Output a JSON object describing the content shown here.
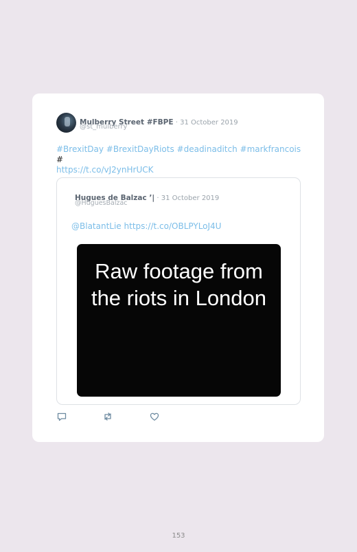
{
  "tweet": {
    "author_name": "Mulberry Street #FBPE",
    "separator": " · ",
    "date": "31 October 2019",
    "handle": "@st_mulberry",
    "text_links": "#BrexitDay #BrexitDayRiots #deadinaditch #markfrancois",
    "text_hash": " #",
    "text_url": "https://t.co/vJ2ynHrUCK"
  },
  "quoted_tweet": {
    "author_name": "Hugues de Balzac ’|",
    "separator": " · ",
    "date": "31 October 2019",
    "handle": "@HuguesBalzac",
    "text": "@BlatantLie https://t.co/OBLPYLoJ4U",
    "media_caption_line1": "Raw footage from",
    "media_caption_line2": "the riots in London"
  },
  "actions": {
    "icons": [
      "reply-icon",
      "retweet-icon",
      "like-icon"
    ]
  },
  "colors": {
    "link": "#7bbde8",
    "background": "#ece6ed"
  },
  "page_number": "153"
}
